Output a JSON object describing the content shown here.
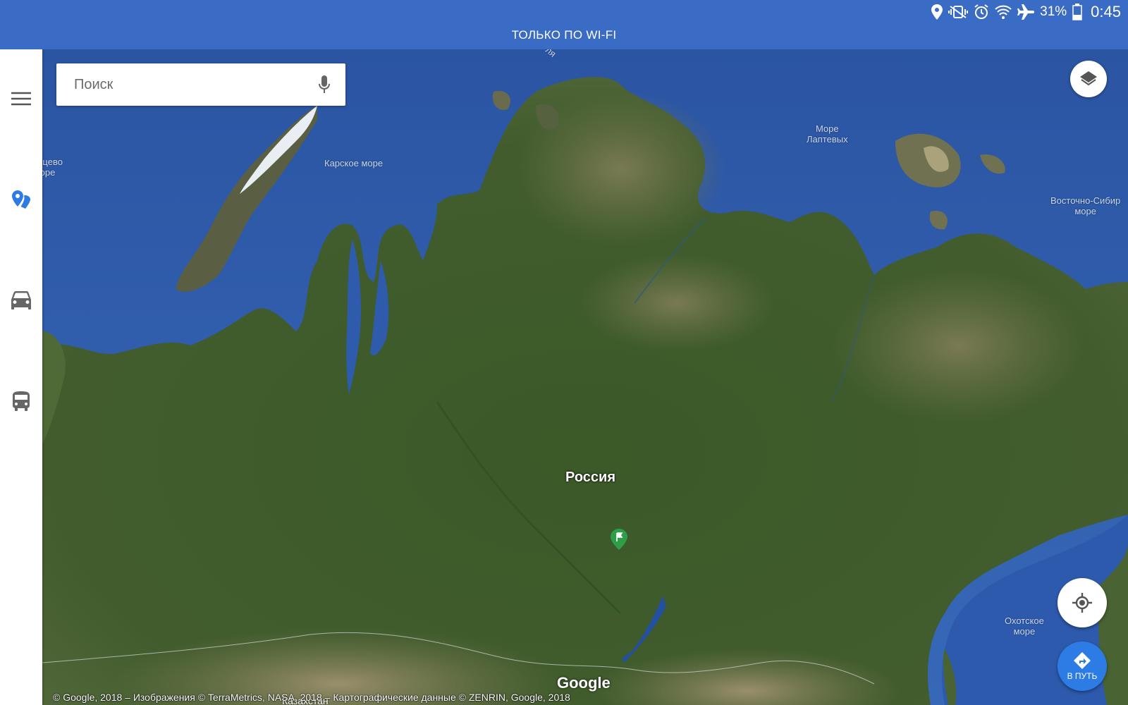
{
  "status_bar": {
    "battery": "31%",
    "time": "0:45",
    "icons": [
      "location-icon",
      "mute-vibrate-icon",
      "alarm-icon",
      "wifi-icon",
      "airplane-icon",
      "battery-icon"
    ]
  },
  "banner": {
    "text": "ТОЛЬКО ПО WI-FI"
  },
  "search": {
    "placeholder": "Поиск"
  },
  "nav_rail": {
    "items": [
      {
        "icon": "menu-icon"
      },
      {
        "icon": "explore-places-icon",
        "active": true
      },
      {
        "icon": "car-icon"
      },
      {
        "icon": "transit-icon"
      }
    ]
  },
  "map": {
    "labels": {
      "kara_sea": "Карское море",
      "laptev_sea_1": "Море",
      "laptev_sea_2": "Лаптевых",
      "east_siberian_1": "Восточно-Сибир",
      "east_siberian_2": "море",
      "pechora_1": "енцево",
      "pechora_2": "оре",
      "okhotsk_1": "Охотское",
      "okhotsk_2": "море",
      "country": "Россия",
      "kazakhstan": "Казахстан",
      "top_cut": "ля"
    },
    "pin_icon": "flag-pin-icon"
  },
  "buttons": {
    "layers_icon": "layers-icon",
    "my_location_icon": "my-location-icon",
    "directions_label": "В ПУТЬ",
    "directions_icon": "directions-icon"
  },
  "footer": {
    "logo": "Google",
    "attribution": "© Google, 2018 – Изображения © TerraMetrics, NASA, 2018 – Картографические данные © ZENRIN, Google, 2018"
  },
  "colors": {
    "accent": "#3a6cc6",
    "nav_active": "#2d7be4",
    "sea": "#2f5fb0",
    "land": "#3d5a2a"
  }
}
